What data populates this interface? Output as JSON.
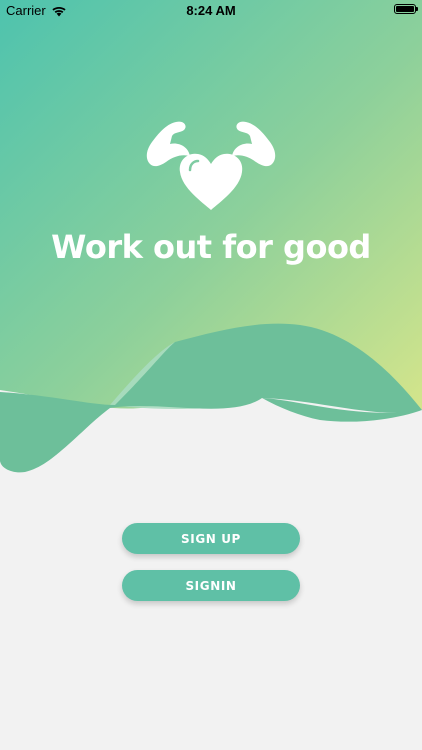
{
  "status_bar": {
    "carrier": "Carrier",
    "time": "8:24 AM",
    "wifi_icon": "wifi-icon",
    "battery_icon": "battery-icon"
  },
  "hero": {
    "logo_icon": "flexing-arms-heart-icon",
    "tagline": "Work out for good",
    "gradient_top": "#4ec3ae",
    "gradient_bottom": "#d4e58b"
  },
  "actions": {
    "signup_label": "SIGN UP",
    "signin_label": "SIGNIN"
  },
  "colors": {
    "button": "#5fc0a6",
    "wave": "#6dbf9a",
    "background": "#f2f2f2"
  }
}
